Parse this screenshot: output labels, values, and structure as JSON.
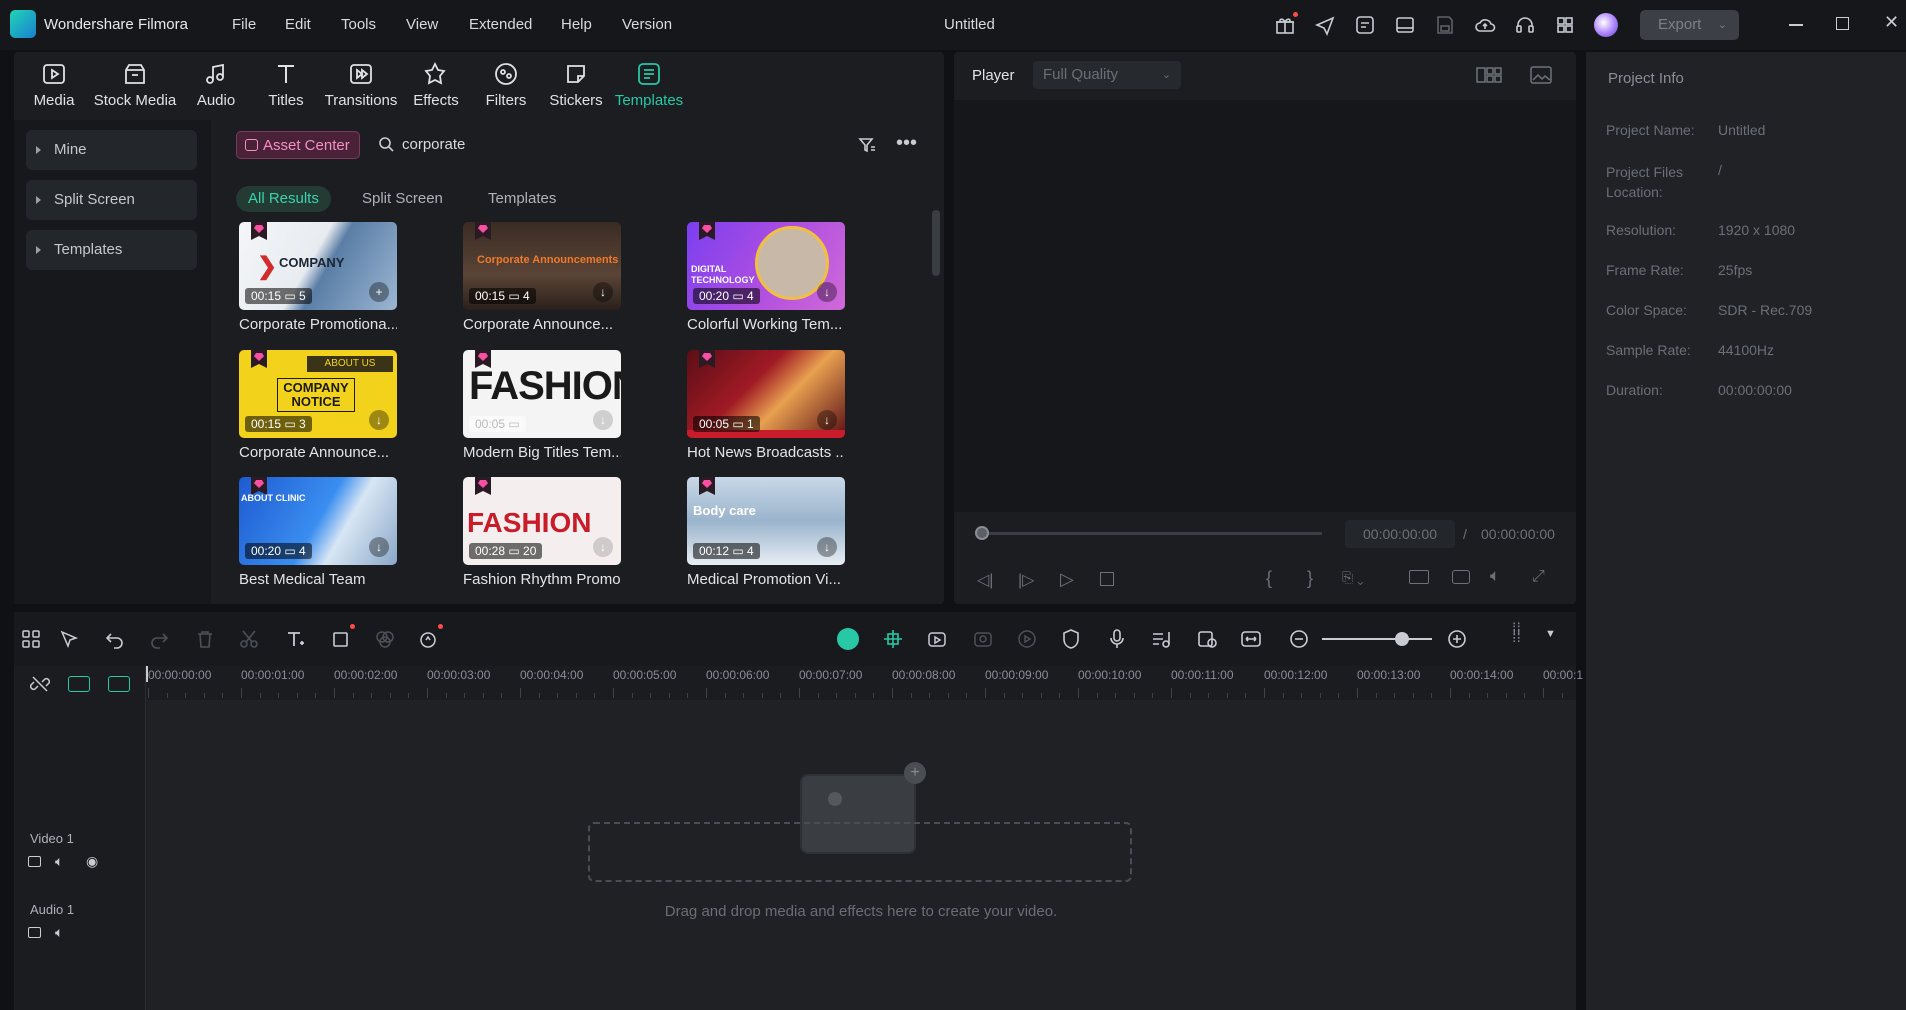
{
  "app": {
    "name": "Wondershare Filmora",
    "document_title": "Untitled",
    "export_label": "Export"
  },
  "menu": [
    "File",
    "Edit",
    "Tools",
    "View",
    "Extended",
    "Help",
    "Version"
  ],
  "toolbar": [
    "Media",
    "Stock Media",
    "Audio",
    "Titles",
    "Transitions",
    "Effects",
    "Filters",
    "Stickers",
    "Templates"
  ],
  "sidebar": [
    "Mine",
    "Split Screen",
    "Templates"
  ],
  "search": {
    "asset_center": "Asset Center",
    "query": "corporate"
  },
  "filters": [
    "All Results",
    "Split Screen",
    "Templates"
  ],
  "cards": [
    {
      "title": "Corporate Promotiona...",
      "duration": "00:15",
      "count": "5",
      "thumb_text": "COMPANY"
    },
    {
      "title": "Corporate Announce...",
      "duration": "00:15",
      "count": "4",
      "thumb_text": "Corporate Announcements"
    },
    {
      "title": "Colorful Working Tem...",
      "duration": "00:20",
      "count": "4",
      "thumb_text": "DIGITAL TECHNOLOGY"
    },
    {
      "title": "Corporate Announce...",
      "duration": "00:15",
      "count": "3",
      "thumb_text": "COMPANY NOTICE"
    },
    {
      "title": "Modern Big Titles Tem...",
      "duration": "00:05",
      "count": "",
      "thumb_text": "FASHION"
    },
    {
      "title": "Hot News Broadcasts ...",
      "duration": "00:05",
      "count": "1",
      "thumb_text": ""
    },
    {
      "title": "Best Medical Team",
      "duration": "00:20",
      "count": "4",
      "thumb_text": "ABOUT CLINIC"
    },
    {
      "title": "Fashion Rhythm Promo",
      "duration": "00:28",
      "count": "20",
      "thumb_text": "FASHION"
    },
    {
      "title": "Medical Promotion Vi...",
      "duration": "00:12",
      "count": "4",
      "thumb_text": "Body care"
    }
  ],
  "player": {
    "label": "Player",
    "quality": "Full Quality",
    "current": "00:00:00:00",
    "sep": "/",
    "total": "00:00:00:00"
  },
  "project_info": {
    "title": "Project Info",
    "rows": [
      {
        "label": "Project Name:",
        "value": "Untitled"
      },
      {
        "label": "Project Files Location:",
        "value": "/"
      },
      {
        "label": "Resolution:",
        "value": "1920 x 1080"
      },
      {
        "label": "Frame Rate:",
        "value": "25fps"
      },
      {
        "label": "Color Space:",
        "value": "SDR - Rec.709"
      },
      {
        "label": "Sample Rate:",
        "value": "44100Hz"
      },
      {
        "label": "Duration:",
        "value": "00:00:00:00"
      }
    ]
  },
  "timeline": {
    "ticks": [
      "00:00:00:00",
      "00:00:01:00",
      "00:00:02:00",
      "00:00:03:00",
      "00:00:04:00",
      "00:00:05:00",
      "00:00:06:00",
      "00:00:07:00",
      "00:00:08:00",
      "00:00:09:00",
      "00:00:10:00",
      "00:00:11:00",
      "00:00:12:00",
      "00:00:13:00",
      "00:00:14:00",
      "00:00:1"
    ],
    "tracks": [
      "Video 1",
      "Audio 1"
    ],
    "drop_text": "Drag and drop media and effects here to create your video."
  }
}
